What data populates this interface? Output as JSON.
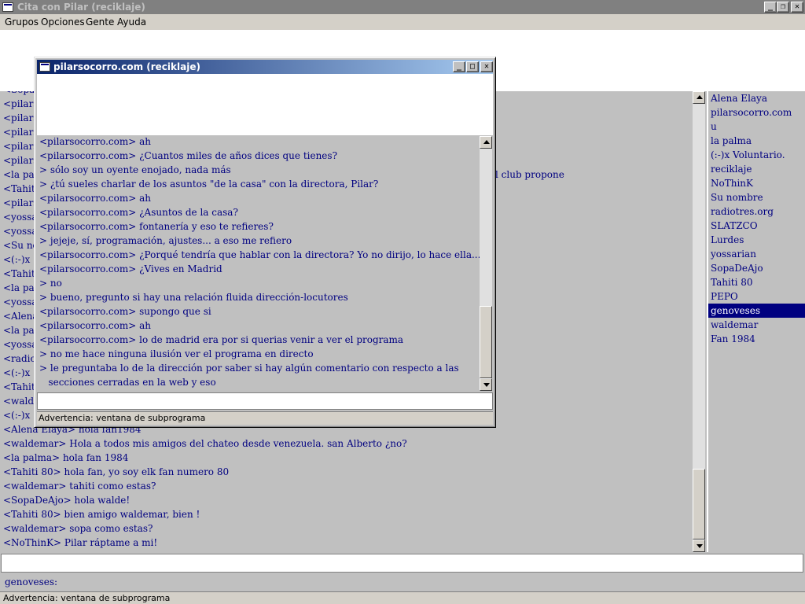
{
  "window": {
    "title": "Cita con Pilar (reciklaje)",
    "controls": {
      "minimize": "_",
      "restore": "❐",
      "close": "✕"
    }
  },
  "menu": [
    "Grupos",
    "Opciones",
    "Gente",
    "Ayuda"
  ],
  "main_chat": {
    "partial_lines": [
      "<Sopa",
      "<pilars",
      "<pilars",
      "<pilars",
      "<pilars",
      "<pilars",
      "<la pal",
      "<Tahiti",
      "<pilars",
      "<yossa",
      "<yossa",
      "<Su no",
      "<(:-)x",
      "<Tahiti",
      "<la pal",
      "<yossa",
      "<Alena",
      "<la pal",
      "<yossa",
      "<radiot",
      "<(:-)x",
      "<Tahiti",
      "<walde",
      "<(:-)x"
    ],
    "partial_fragment": "l club propone",
    "visible_lines": [
      "<Alena Elaya> hola fan1984",
      "<waldemar>  Hola  a  todos  mis  amigos  del  chateo  desde  venezuela.  san  Alberto  ¿no?",
      "<la palma> hola fan 1984",
      "<Tahiti 80> hola fan, yo soy elk fan numero 80",
      "<waldemar> tahiti como  estas?",
      "<SopaDeAjo> hola walde!",
      "<Tahiti 80> bien amigo waldemar, bien !",
      "<waldemar> sopa  como  estas?",
      "<NoThinK> Pilar ráptame a mi!"
    ]
  },
  "users": [
    "Alena Elaya",
    "pilarsocorro.com",
    "u",
    "la palma",
    "(:-)x Voluntario.",
    "reciklaje",
    "NoThinK",
    "Su nombre",
    "radiotres.org",
    "SLATZCO",
    "Lurdes",
    "yossarian",
    "SopaDeAjo",
    "Tahiti 80",
    "PEPO",
    "genoveses",
    "waldemar",
    "Fan 1984"
  ],
  "selected_user": "genoveses",
  "input": {
    "value": ""
  },
  "nick_label": "genoveses:",
  "status": "Advertencia: ventana de subprograma",
  "subwindow": {
    "title": "pilarsocorro.com (reciklaje)",
    "controls": {
      "minimize": "_",
      "maximize": "□",
      "close": "✕"
    },
    "lines": [
      "<pilarsocorro.com> ah",
      "<pilarsocorro.com> ¿Cuantos miles de años dices que tienes?",
      "> sólo soy un oyente enojado, nada más",
      "> ¿tú sueles charlar de los asuntos \"de la casa\" con la directora, Pilar?",
      "<pilarsocorro.com> ah",
      "<pilarsocorro.com> ¿Asuntos de la casa?",
      "<pilarsocorro.com> fontanería y eso te refieres?",
      "> jejeje, sí, programación, ajustes... a eso me refiero",
      "<pilarsocorro.com> ¿Porqué tendría que hablar con la directora? Yo no dirijo, lo hace ella...",
      "<pilarsocorro.com> ¿Vives en Madrid",
      "> no",
      "> bueno, pregunto si hay una relación fluida dirección-locutores",
      "<pilarsocorro.com> supongo que si",
      "<pilarsocorro.com> ah",
      "<pilarsocorro.com> lo de madrid era por si querias venir a ver el programa",
      "> no me hace ninguna ilusión ver el programa en directo",
      "> le preguntaba lo de la dirección por saber si hay algún comentario con respecto a las",
      "   secciones cerradas en la web y eso"
    ],
    "input": {
      "value": ""
    },
    "status": "Advertencia: ventana de subprograma"
  }
}
